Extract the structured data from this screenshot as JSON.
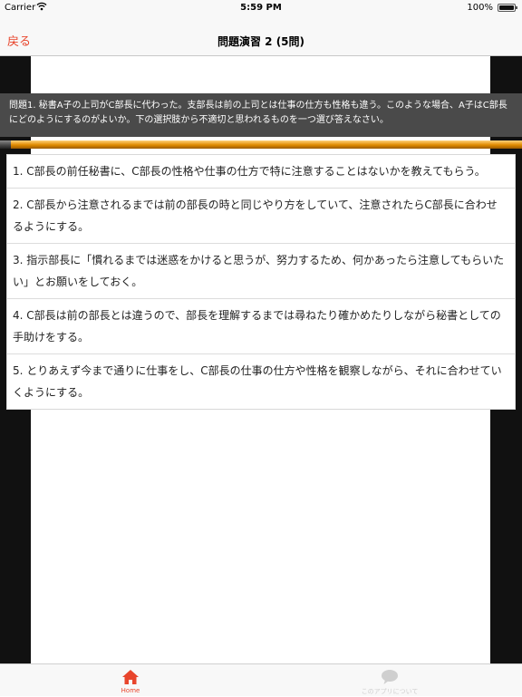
{
  "status": {
    "carrier": "Carrier",
    "time": "5:59 PM",
    "battery": "100%"
  },
  "nav": {
    "back_label": "戻る",
    "title": "問題演習 2 (5問)"
  },
  "question": {
    "text": "問題1. 秘書A子の上司がC部長に代わった。支部長は前の上司とは仕事の仕方も性格も違う。このような場合、A子はC部長にどのようにするのがよいか。下の選択肢から不適切と思われるものを一つ選び答えなさい。"
  },
  "progress": {
    "fraction": 0.02
  },
  "options": [
    {
      "label": "1. C部長の前任秘書に、C部長の性格や仕事の仕方で特に注意することはないかを教えてもらう。"
    },
    {
      "label": "2. C部長から注意されるまでは前の部長の時と同じやり方をしていて、注意されたらC部長に合わせるようにする。"
    },
    {
      "label": "3. 指示部長に「慣れるまでは迷惑をかけると思うが、努力するため、何かあったら注意してもらいたい」とお願いをしておく。"
    },
    {
      "label": "4. C部長は前の部長とは違うので、部長を理解するまでは尋ねたり確かめたりしながら秘書としての手助けをする。"
    },
    {
      "label": "5. とりあえず今まで通りに仕事をし、C部長の仕事の仕方や性格を観察しながら、それに合わせていくようにする。"
    }
  ],
  "tabs": {
    "home_label": "Home",
    "about_label": "このアプリについて"
  },
  "colors": {
    "accent": "#e8452c",
    "inactive": "#cfcfcf",
    "question_bg": "#4a4a4a",
    "progress": "#e08a00"
  },
  "icons": {
    "home": "home-icon",
    "about": "chat-bubble-icon",
    "wifi": "wifi-icon",
    "battery": "battery-icon"
  }
}
